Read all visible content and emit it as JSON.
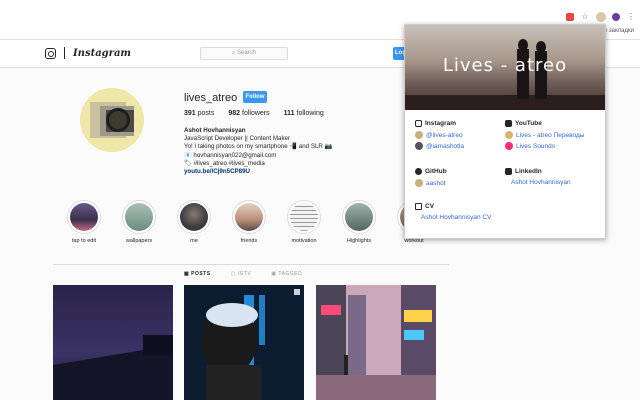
{
  "browser": {
    "bookmarks_label": "Другие закладки"
  },
  "ig": {
    "wordmark": "Instagram",
    "search_placeholder": "Search",
    "login_label": "Log"
  },
  "profile": {
    "username": "lives_atreo",
    "follow_label": "Follow",
    "posts": "391",
    "posts_label": "posts",
    "followers": "982",
    "followers_label": "followers",
    "following": "111",
    "following_label": "following",
    "bio_name": "Ashot Hovhannisyan",
    "bio_lines": [
      "JavaScript Developer || Content Maker",
      "Yo! I taking photos on my smartphone 📲 and SLR 📷",
      "📧 hovhannisyan022@gmail.com",
      "🏷 #lives_atreo #lives_media"
    ],
    "bio_link": "youtu.be/lCj9n5CP89U"
  },
  "highlights": [
    {
      "label": "tap to edit",
      "color": "#5b4a6e"
    },
    {
      "label": "wallpapers",
      "color": "#8aa39a"
    },
    {
      "label": "me",
      "color": "#4d4d52"
    },
    {
      "label": "friends",
      "color": "#c9a48a"
    },
    {
      "label": "motivation",
      "color": "#eeeeee"
    },
    {
      "label": "Highlights",
      "color": "#7b8f86"
    },
    {
      "label": "workout",
      "color": "#9a8b7a"
    }
  ],
  "tabs": {
    "posts": "POSTS",
    "igtv": "IGTV",
    "tagged": "TAGGED"
  },
  "popup": {
    "title": "Lives - atreo",
    "instagram": {
      "heading": "Instagram",
      "items": [
        "@lives-atreo",
        "@iamashotla"
      ]
    },
    "youtube": {
      "heading": "YouTube",
      "items": [
        "Lives - atreo Переводы",
        "Lives Sounds"
      ]
    },
    "github": {
      "heading": "GitHub",
      "items": [
        "aashot"
      ]
    },
    "linkedin": {
      "heading": "LinkedIn",
      "items": [
        "Ashot Hovhannisyan"
      ]
    },
    "cv": {
      "heading": "CV",
      "items": [
        "Ashot Hovhannisyan CV"
      ]
    }
  },
  "colors": {
    "ig_blue": "#3897f0",
    "link_blue": "#3367d6",
    "youtube_red": "#ff0000",
    "linkedin_blue": "#0077b5"
  }
}
